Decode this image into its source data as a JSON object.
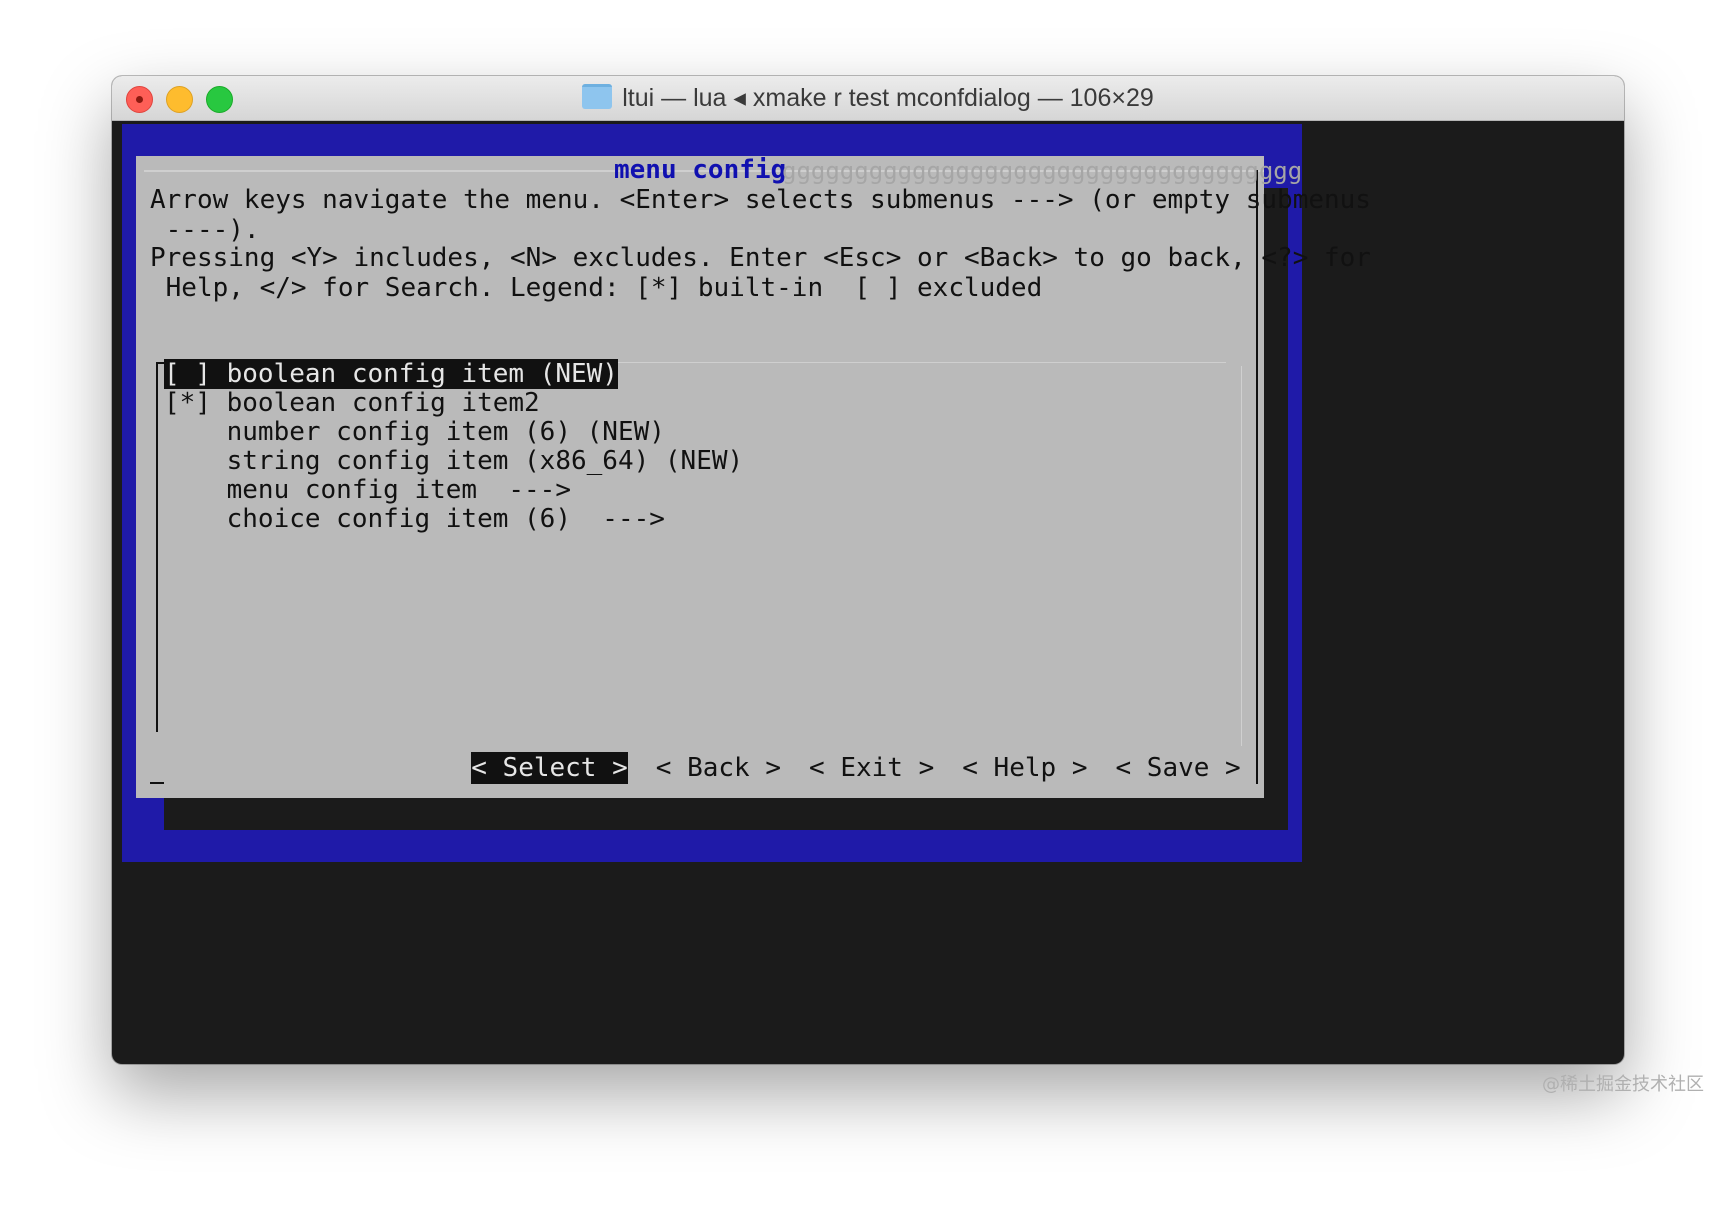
{
  "window": {
    "title": "ltui — lua ◂ xmake r test mconfdialog — 106×29",
    "icon": "folder-icon"
  },
  "dialog": {
    "title": "menu config",
    "title_trail": "gggggggggggggggggggggggggggggggggggg",
    "help_lines": [
      "Arrow keys navigate the menu. <Enter> selects submenus ---> (or empty submenus",
      " ----).",
      "Pressing <Y> includes, <N> excludes. Enter <Esc> or <Back> to go back, <?> for",
      " Help, </> for Search. Legend: [*] built-in  [ ] excluded"
    ],
    "items": [
      {
        "label": "[ ] boolean config item (NEW)",
        "selected": true
      },
      {
        "label": "[*] boolean config item2",
        "selected": false
      },
      {
        "label": "    number config item (6) (NEW)",
        "selected": false
      },
      {
        "label": "    string config item (x86_64) (NEW)",
        "selected": false
      },
      {
        "label": "    menu config item  --->",
        "selected": false
      },
      {
        "label": "    choice config item (6)  --->",
        "selected": false
      }
    ],
    "buttons": [
      {
        "label": "< Select >",
        "selected": true
      },
      {
        "label": "< Back >",
        "selected": false
      },
      {
        "label": "< Exit >",
        "selected": false
      },
      {
        "label": "< Help >",
        "selected": false
      },
      {
        "label": "< Save >",
        "selected": false
      }
    ]
  },
  "watermark": "@稀土掘金技术社区",
  "colors": {
    "terminal_bg": "#1b1b1b",
    "screen_blue": "#1f1aa8",
    "dialog_bg": "#bababa",
    "title_blue": "#1010b0",
    "highlight_bg": "#111111"
  }
}
